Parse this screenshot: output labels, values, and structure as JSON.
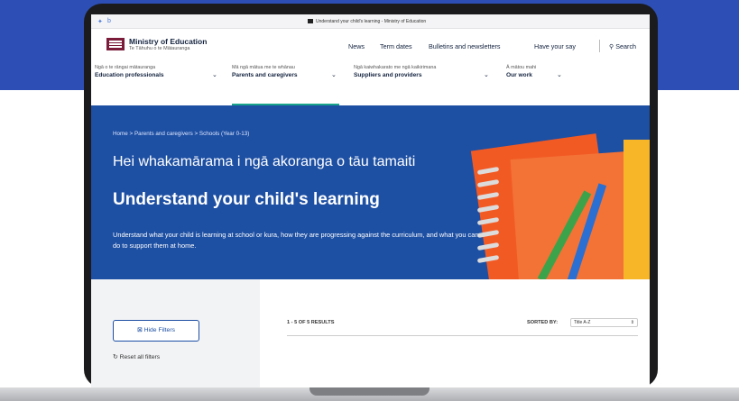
{
  "browser": {
    "tab_title": "Understand your child's learning - Ministry of Education"
  },
  "logo": {
    "title": "Ministry of Education",
    "subtitle": "Te Tāhuhu o te Mātauranga"
  },
  "top_nav": {
    "news": "News",
    "term_dates": "Term dates",
    "bulletins": "Bulletins and newsletters",
    "have_your_say": "Have your say",
    "search": "Search"
  },
  "main_nav": [
    {
      "sub": "Ngā o te rāngai mātauranga",
      "label": "Education professionals"
    },
    {
      "sub": "Mā ngā mātua me te whānau",
      "label": "Parents and caregivers"
    },
    {
      "sub": "Ngā kaiwhakarato me ngā kaikirimana",
      "label": "Suppliers and providers"
    },
    {
      "sub": "Ā mātou mahi",
      "label": "Our work"
    }
  ],
  "hero": {
    "breadcrumb": "Home  >  Parents and caregivers  >  Schools (Year 0-13)",
    "title_maori": "Hei whakamārama i ngā akoranga o tāu tamaiti",
    "title_english": "Understand your child's learning",
    "description": "Understand what your child is learning at school or kura, how they are progressing against the curriculum, and what you can do to support them at home."
  },
  "filters": {
    "hide_label": "Hide Filters",
    "reset_label": "Reset all filters"
  },
  "results": {
    "count_text": "1 - 5 OF 5 RESULTS",
    "sorted_label": "SORTED BY:",
    "sort_value": "Title A-Z"
  },
  "colors": {
    "brand_maroon": "#7b1c3b",
    "hero_blue": "#1d4fa3",
    "accent_teal": "#1aa48c",
    "bg_blue": "#2d4fb5"
  },
  "icons": [
    "search-icon",
    "chevron-down-icon",
    "filter-icon",
    "reset-icon"
  ]
}
